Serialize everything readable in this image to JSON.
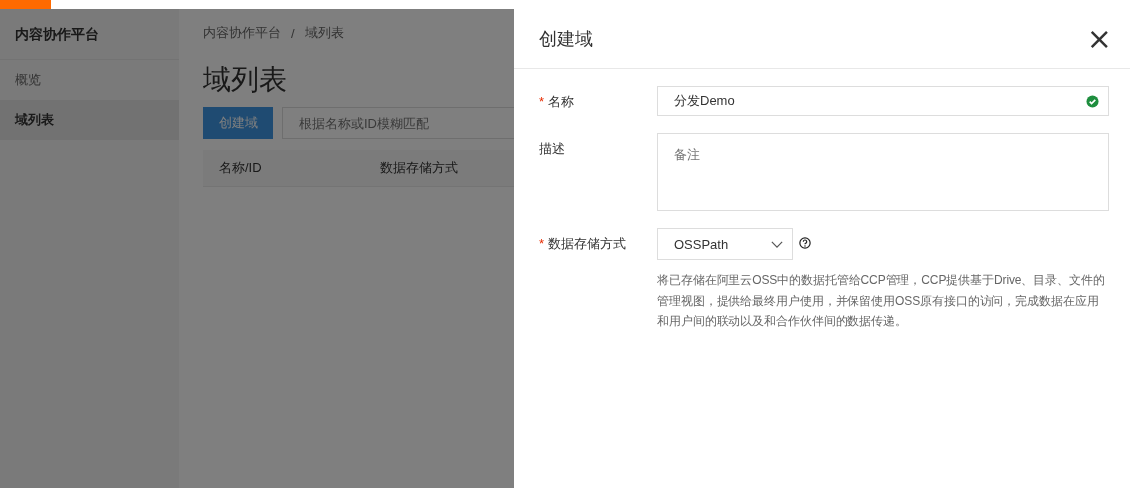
{
  "sidebar": {
    "title": "内容协作平台",
    "items": [
      {
        "label": "概览",
        "selected": false
      },
      {
        "label": "域列表",
        "selected": true
      }
    ]
  },
  "breadcrumb": [
    "内容协作平台",
    "域列表"
  ],
  "breadcrumb_separator": "/",
  "required_mark": "*",
  "page_title": "域列表",
  "toolbar": {
    "create_button": "创建域",
    "search": {
      "placeholder": "根据名称或ID模糊匹配"
    }
  },
  "table": {
    "columns": [
      "名称/ID",
      "数据存储方式"
    ]
  },
  "drawer": {
    "title": "创建域",
    "close": "×",
    "fields": [
      {
        "kind": "input",
        "label": "名称",
        "required": true,
        "value": "分发Demo",
        "valid": true
      },
      {
        "kind": "textarea",
        "label": "描述",
        "required": false,
        "placeholder": "备注"
      },
      {
        "kind": "select",
        "label": "数据存储方式",
        "required": true,
        "value": "OSSPath",
        "help_icon": true,
        "help": "将已存储在阿里云OSS中的数据托管给CCP管理，CCP提供基于Drive、目录、文件的管理视图，提供给最终用户使用，并保留使用OSS原有接口的访问，完成数据在应用和用户间的联动以及和合作伙伴间的数据传递。"
      }
    ]
  }
}
